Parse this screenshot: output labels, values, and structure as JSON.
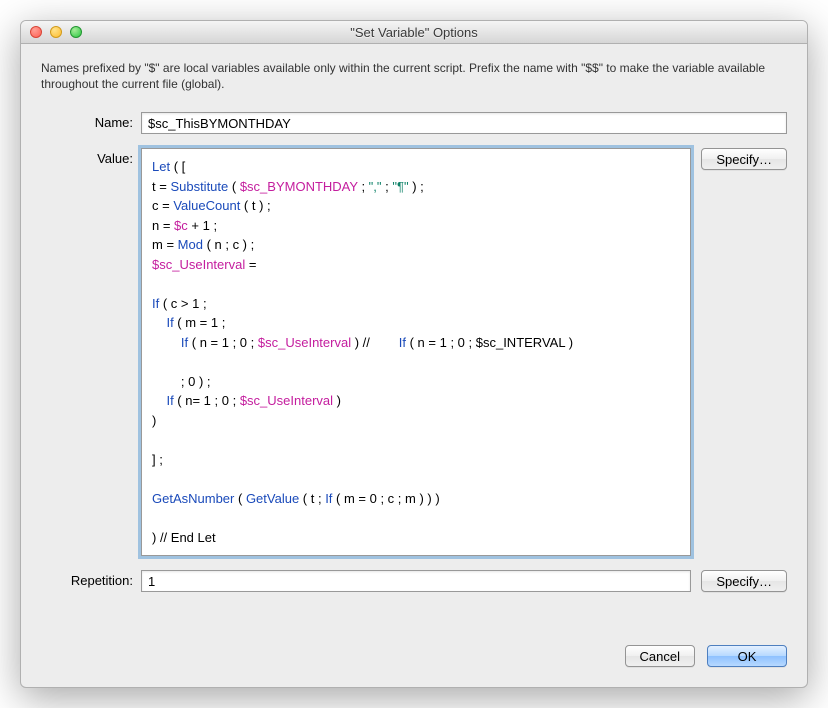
{
  "title": "\"Set Variable\" Options",
  "description": "Names prefixed by \"$\" are local variables available only within the current script. Prefix the name with \"$$\" to make the variable available throughout the current file (global).",
  "labels": {
    "name": "Name:",
    "value": "Value:",
    "repetition": "Repetition:"
  },
  "fields": {
    "name": "$sc_ThisBYMONTHDAY",
    "repetition": "1"
  },
  "code": {
    "tokens": [
      {
        "t": "kw",
        "v": "Let"
      },
      {
        "t": "p",
        "v": " ( [\n"
      },
      {
        "t": "p",
        "v": "t = "
      },
      {
        "t": "kw",
        "v": "Substitute"
      },
      {
        "t": "p",
        "v": " ( "
      },
      {
        "t": "var",
        "v": "$sc_BYMONTHDAY"
      },
      {
        "t": "p",
        "v": " ; "
      },
      {
        "t": "str",
        "v": "\",\""
      },
      {
        "t": "p",
        "v": " ; "
      },
      {
        "t": "str",
        "v": "\"¶\""
      },
      {
        "t": "p",
        "v": " ) ;\n"
      },
      {
        "t": "p",
        "v": "c = "
      },
      {
        "t": "kw",
        "v": "ValueCount"
      },
      {
        "t": "p",
        "v": " ( t ) ;\n"
      },
      {
        "t": "p",
        "v": "n = "
      },
      {
        "t": "var",
        "v": "$c"
      },
      {
        "t": "p",
        "v": " + 1 ;\n"
      },
      {
        "t": "p",
        "v": "m = "
      },
      {
        "t": "kw",
        "v": "Mod"
      },
      {
        "t": "p",
        "v": " ( n ; c ) ;\n"
      },
      {
        "t": "var",
        "v": "$sc_UseInterval"
      },
      {
        "t": "p",
        "v": " = \n\n"
      },
      {
        "t": "kw",
        "v": "If"
      },
      {
        "t": "p",
        "v": " ( c > 1 ;\n"
      },
      {
        "t": "p",
        "v": "    "
      },
      {
        "t": "kw",
        "v": "If"
      },
      {
        "t": "p",
        "v": " ( m = 1 ;\n"
      },
      {
        "t": "p",
        "v": "        "
      },
      {
        "t": "kw",
        "v": "If"
      },
      {
        "t": "p",
        "v": " ( n = 1 ; 0 ; "
      },
      {
        "t": "var",
        "v": "$sc_UseInterval"
      },
      {
        "t": "p",
        "v": " ) //        "
      },
      {
        "t": "kw",
        "v": "If"
      },
      {
        "t": "p",
        "v": " ( n = 1 ; 0 ; $sc_INTERVAL )\n\n"
      },
      {
        "t": "p",
        "v": "        ; 0 ) ;\n"
      },
      {
        "t": "p",
        "v": "    "
      },
      {
        "t": "kw",
        "v": "If"
      },
      {
        "t": "p",
        "v": " ( n= 1 ; 0 ; "
      },
      {
        "t": "var",
        "v": "$sc_UseInterval"
      },
      {
        "t": "p",
        "v": " )\n)\n\n] ;\n\n"
      },
      {
        "t": "kw",
        "v": "GetAsNumber"
      },
      {
        "t": "p",
        "v": " ( "
      },
      {
        "t": "kw",
        "v": "GetValue"
      },
      {
        "t": "p",
        "v": " ( t ; "
      },
      {
        "t": "kw",
        "v": "If"
      },
      {
        "t": "p",
        "v": " ( m = 0 ; c ; m ) ) )\n\n) // End Let"
      }
    ]
  },
  "buttons": {
    "specify": "Specify…",
    "cancel": "Cancel",
    "ok": "OK"
  }
}
